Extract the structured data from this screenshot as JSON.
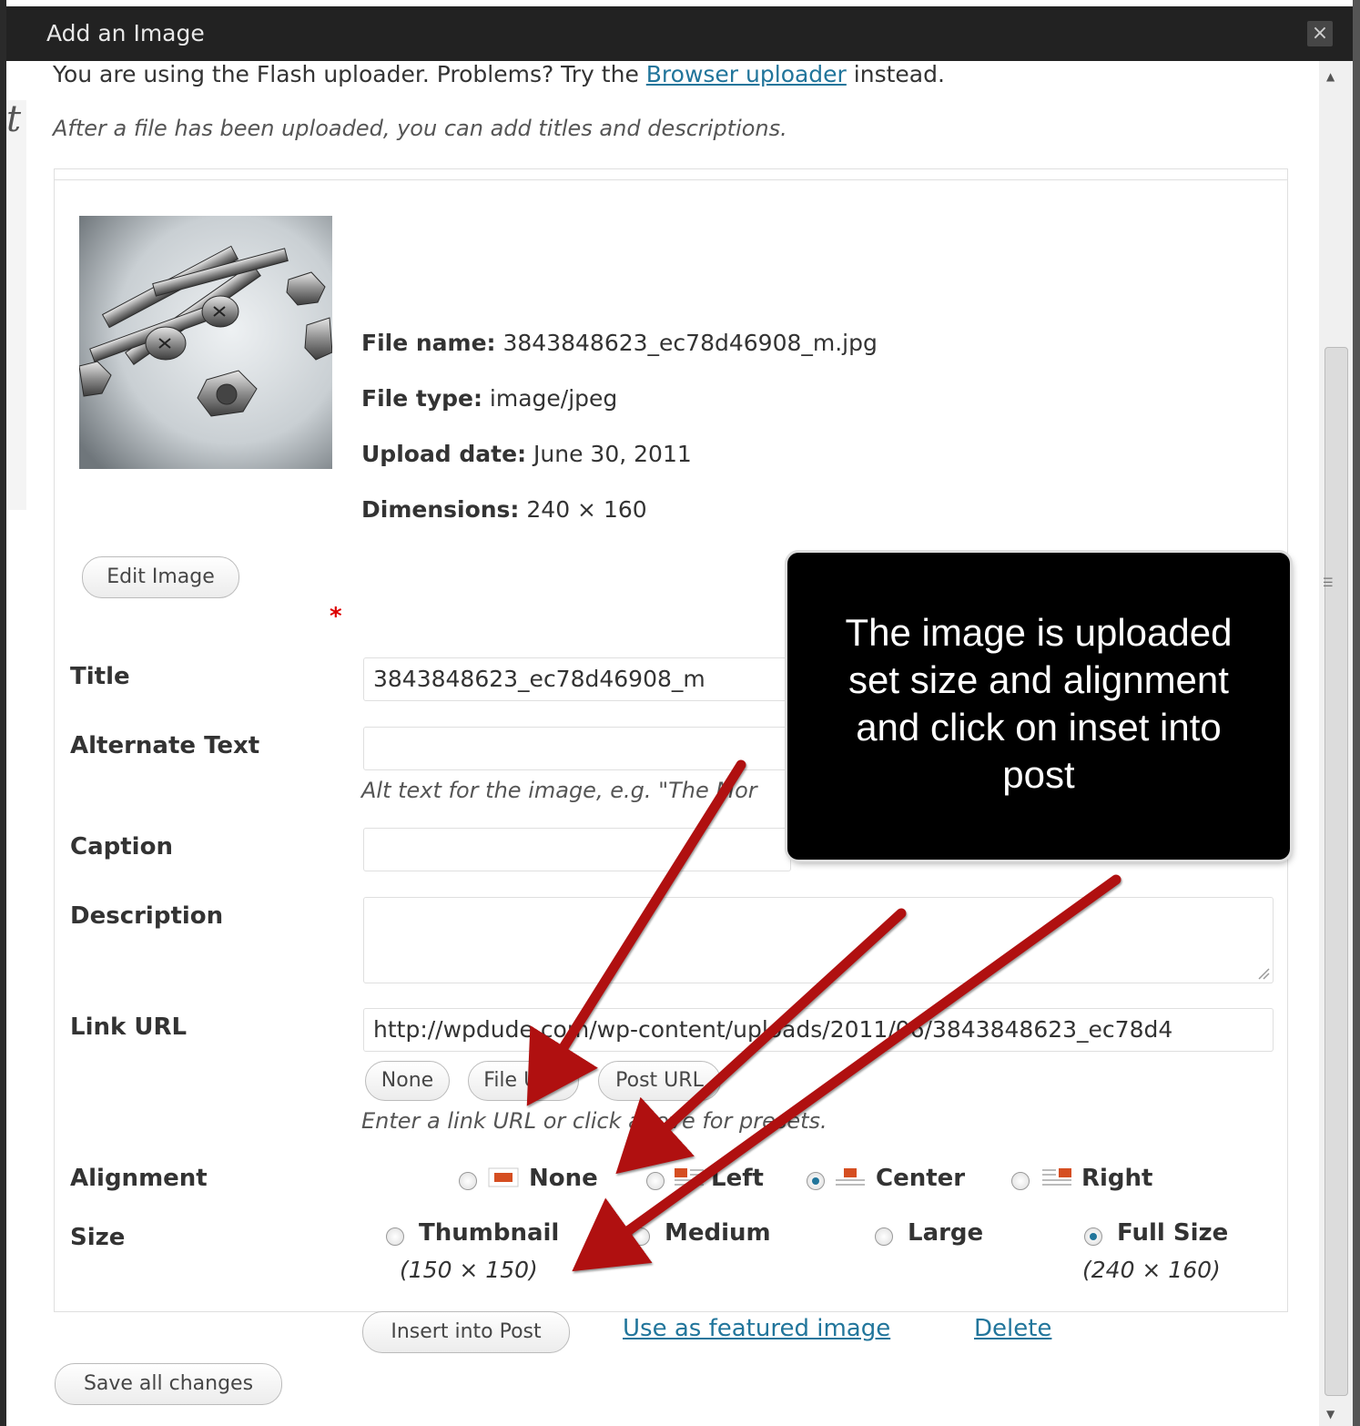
{
  "dialog": {
    "title": "Add an Image",
    "close_label": "×"
  },
  "intro": {
    "prefix": "You are using the Flash uploader. Problems? Try the ",
    "link": "Browser uploader",
    "suffix": " instead.",
    "note": "After a file has been uploaded, you can add titles and descriptions."
  },
  "file": {
    "name_label": "File name:",
    "name_value": " 3843848623_ec78d46908_m.jpg",
    "type_label": "File type:",
    "type_value": " image/jpeg",
    "date_label": "Upload date:",
    "date_value": " June 30, 2011",
    "dims_label": "Dimensions:",
    "dims_value": " 240 × 160",
    "edit_button": "Edit Image"
  },
  "form": {
    "title_label": "Title",
    "title_value": "3843848623_ec78d46908_m",
    "required_mark": "*",
    "alt_label": "Alternate Text",
    "alt_help": "Alt text for the image, e.g. \"The Mor",
    "caption_label": "Caption",
    "description_label": "Description",
    "link_label": "Link URL",
    "link_value": "http://wpdude.com/wp-content/uploads/2011/06/3843848623_ec78d4",
    "link_buttons": [
      "None",
      "File URL",
      "Post URL"
    ],
    "link_help": "Enter a link URL or click above for presets.",
    "alignment_label": "Alignment",
    "alignment_options": [
      "None",
      "Left",
      "Center",
      "Right"
    ],
    "alignment_selected": "Center",
    "size_label": "Size",
    "size_options": [
      {
        "label": "Thumbnail",
        "dims": "(150 × 150)"
      },
      {
        "label": "Medium",
        "dims": ""
      },
      {
        "label": "Large",
        "dims": ""
      },
      {
        "label": "Full Size",
        "dims": "(240 × 160)"
      }
    ],
    "size_selected": "Full Size",
    "insert_button": "Insert into Post",
    "featured_link": "Use as featured image",
    "delete_link": "Delete"
  },
  "save_button": "Save all changes",
  "callout": {
    "line1": "The image is uploaded",
    "line2": "set size and alignment",
    "line3": "and click on inset into",
    "line4": "post"
  },
  "colors": {
    "titlebar": "#222222",
    "link": "#21759b",
    "arrow": "#b01010",
    "callout_bg": "#000000"
  }
}
